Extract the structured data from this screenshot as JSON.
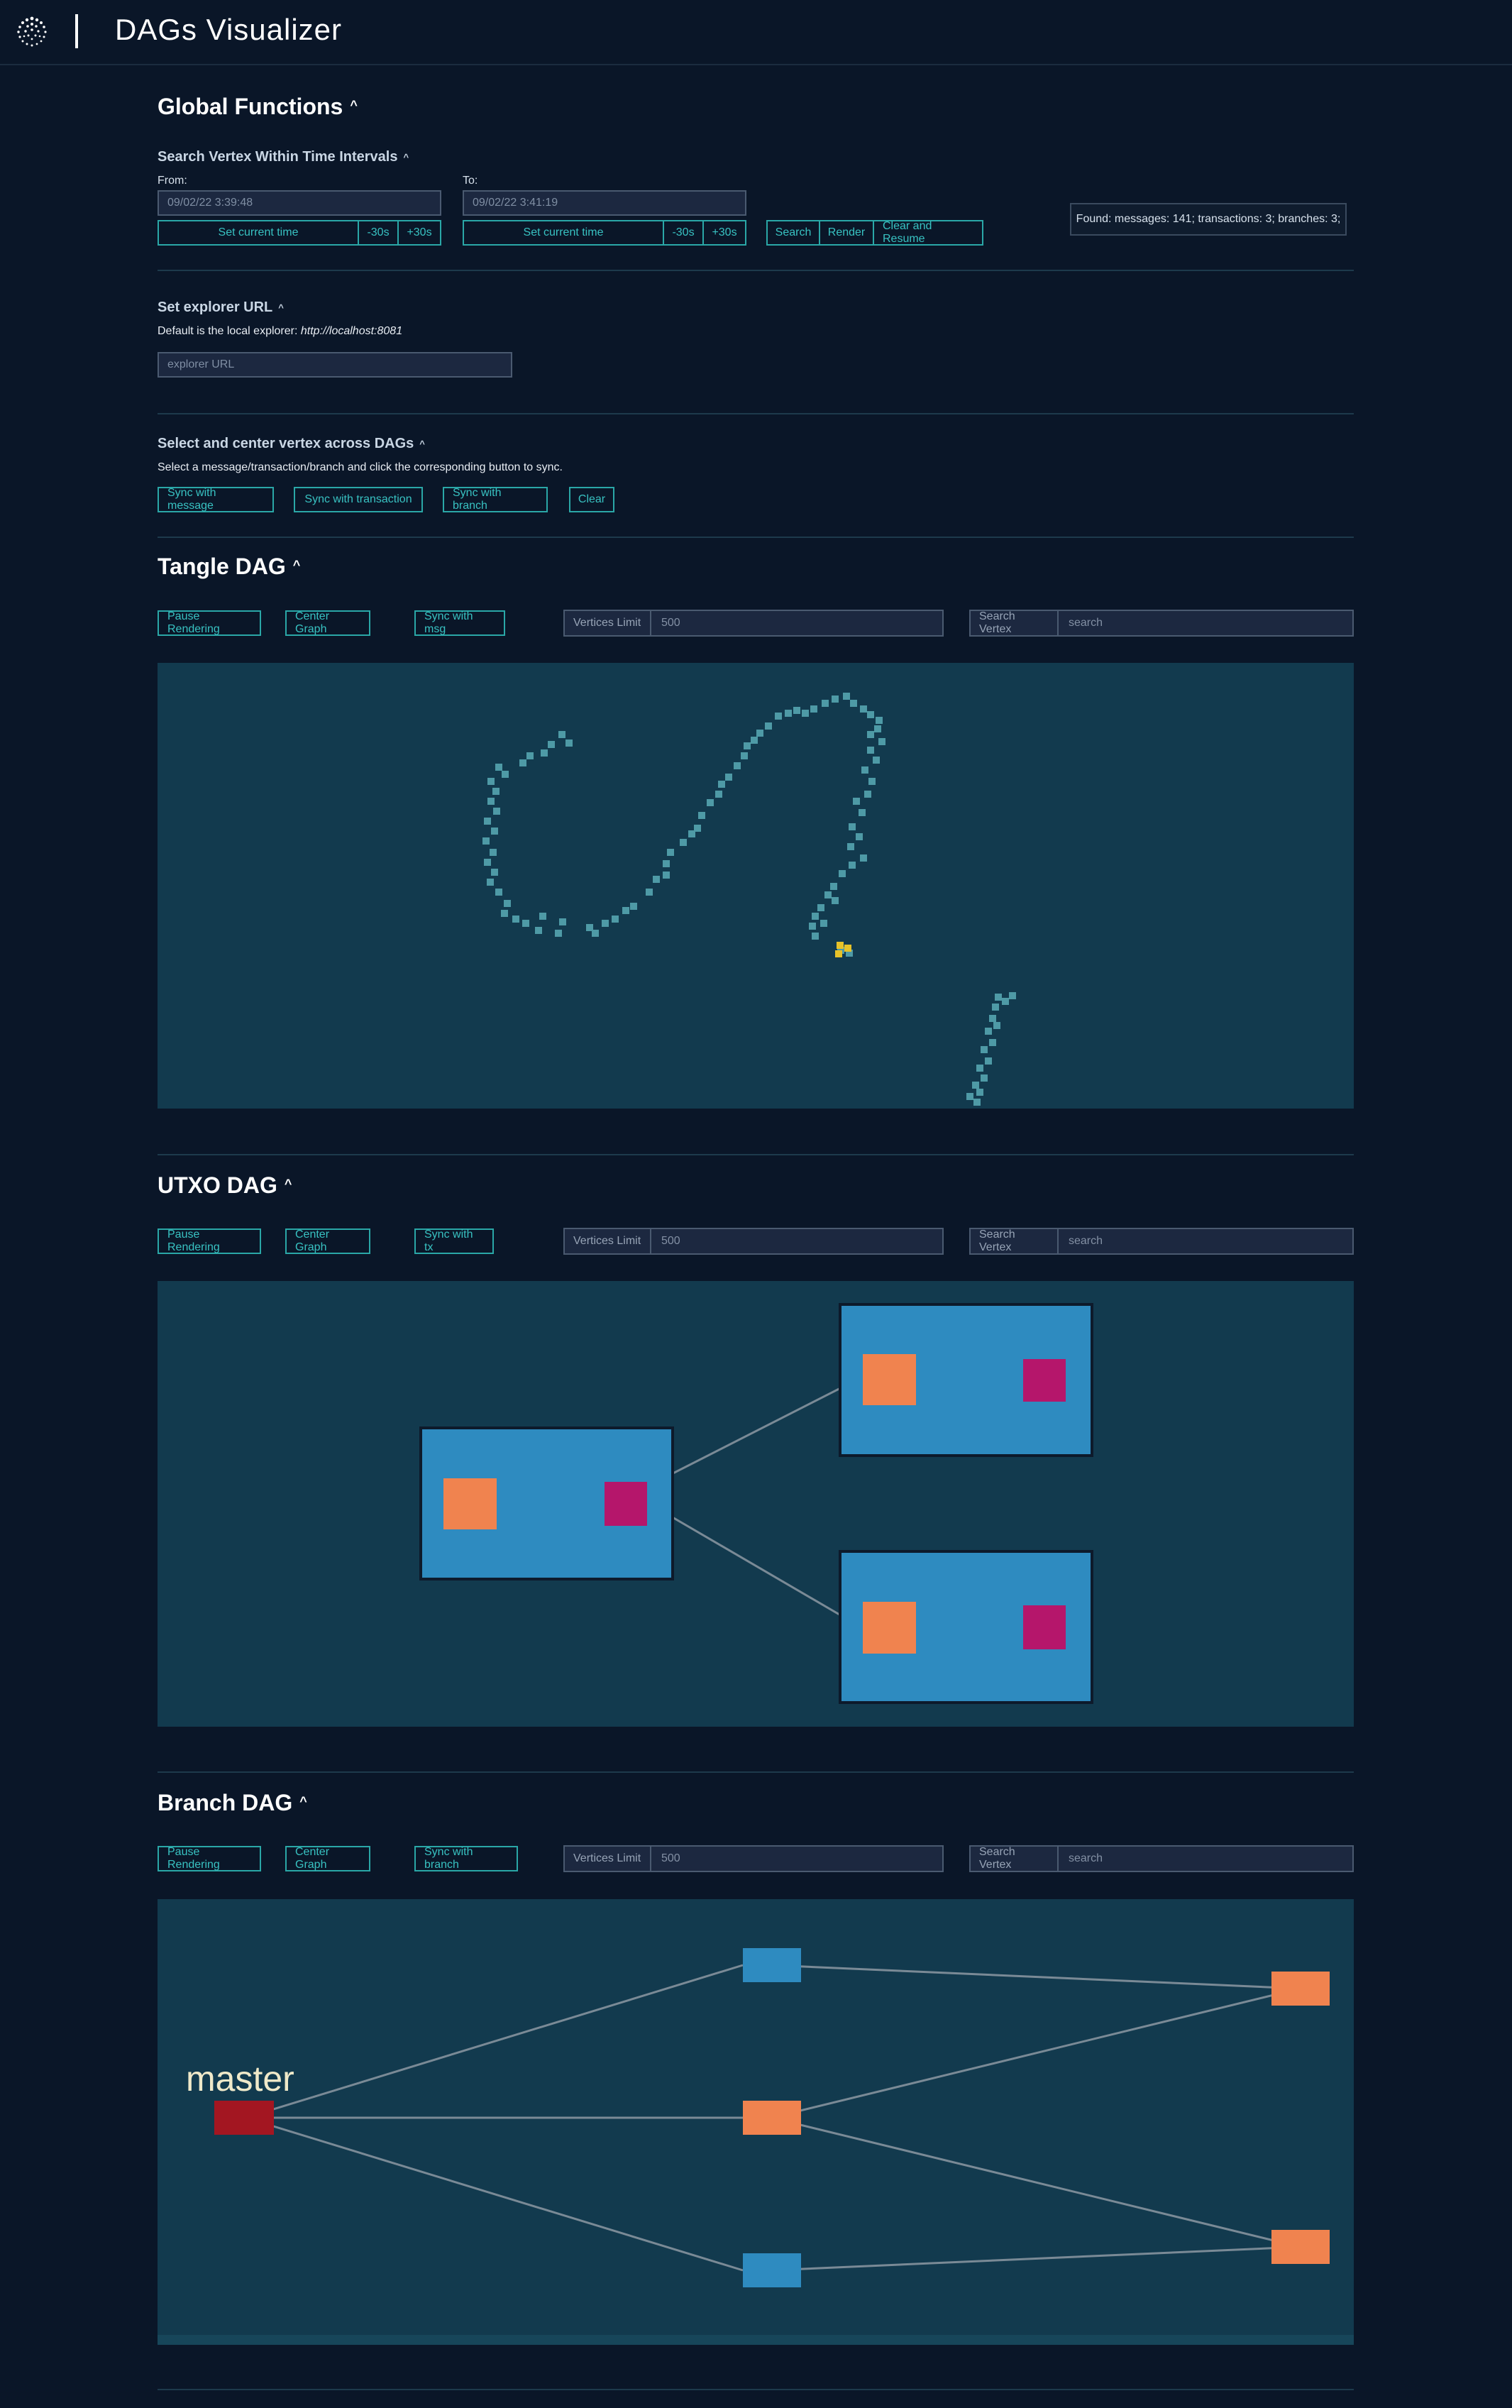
{
  "header": {
    "title": "DAGs Visualizer",
    "logo_icon": "iota-logo-icon"
  },
  "global": {
    "title": "Global Functions",
    "search_vertex": {
      "title": "Search Vertex Within Time Intervals",
      "from_label": "From:",
      "from_value": "09/02/22 3:39:48",
      "to_label": "To:",
      "to_value": "09/02/22 3:41:19",
      "set_current_time": "Set current time",
      "minus30": "-30s",
      "plus30": "+30s",
      "search": "Search",
      "render": "Render",
      "clear_resume": "Clear and Resume",
      "found_text": "Found: messages: 141; transactions: 3; branches: 3;"
    },
    "explorer": {
      "title": "Set explorer URL",
      "default_prefix": "Default is the local explorer: ",
      "default_url": "http://localhost:8081",
      "placeholder": "explorer URL"
    },
    "sync": {
      "title": "Select and center vertex across DAGs",
      "help": "Select a message/transaction/branch and click the corresponding button to sync.",
      "sync_message": "Sync with message",
      "sync_transaction": "Sync with transaction",
      "sync_branch": "Sync with branch",
      "clear": "Clear"
    }
  },
  "tangle": {
    "title": "Tangle DAG",
    "pause": "Pause Rendering",
    "center": "Center Graph",
    "sync": "Sync with msg",
    "limit_label": "Vertices Limit",
    "limit_value": "500",
    "search_label": "Search Vertex",
    "search_placeholder": "search"
  },
  "utxo": {
    "title": "UTXO DAG",
    "pause": "Pause Rendering",
    "center": "Center Graph",
    "sync": "Sync with tx",
    "limit_label": "Vertices Limit",
    "limit_value": "500",
    "search_label": "Search Vertex",
    "search_placeholder": "search"
  },
  "branch": {
    "title": "Branch DAG",
    "pause": "Pause Rendering",
    "center": "Center Graph",
    "sync": "Sync with branch",
    "limit_label": "Vertices Limit",
    "limit_value": "500",
    "search_label": "Search Vertex",
    "search_placeholder": "search",
    "master_label": "master"
  },
  "colors": {
    "accent": "#2aa7a7",
    "canvas_bg": "#123a4e",
    "tangle_node": "#4e9aa6",
    "tangle_highlight": "#e6c229",
    "utxo_tx": "#2e8bc0",
    "utxo_input": "#f0834f",
    "utxo_output": "#b5166b",
    "branch_master": "#a31621",
    "branch_blue": "#2e8bc0",
    "branch_orange": "#f0834f"
  }
}
